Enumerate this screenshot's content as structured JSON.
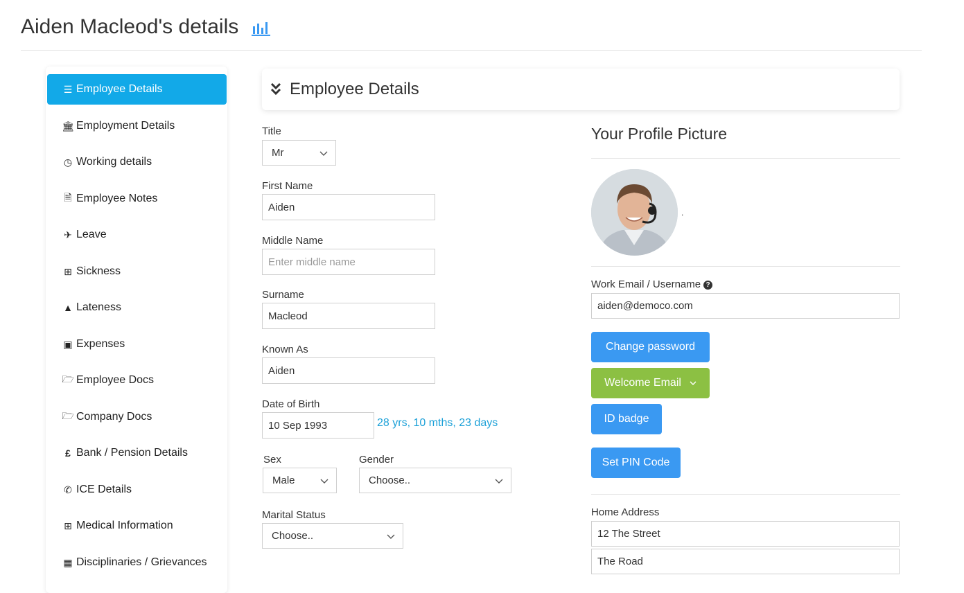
{
  "header": {
    "title": "Aiden Macleod's details",
    "chart_icon": "bar-chart-icon"
  },
  "sidebar": {
    "items": [
      {
        "label": "Employee Details",
        "icon": "list-icon",
        "active": true
      },
      {
        "label": "Employment Details",
        "icon": "bank-icon"
      },
      {
        "label": "Working details",
        "icon": "clock-icon"
      },
      {
        "label": "Employee Notes",
        "icon": "document-icon"
      },
      {
        "label": "Leave",
        "icon": "plane-icon"
      },
      {
        "label": "Sickness",
        "icon": "medkit-icon"
      },
      {
        "label": "Lateness",
        "icon": "warning-icon"
      },
      {
        "label": "Expenses",
        "icon": "money-icon"
      },
      {
        "label": "Employee Docs",
        "icon": "folder-open-icon"
      },
      {
        "label": "Company Docs",
        "icon": "folder-open-icon"
      },
      {
        "label": "Bank / Pension Details",
        "icon": "pound-icon"
      },
      {
        "label": "ICE Details",
        "icon": "phone-icon"
      },
      {
        "label": "Medical Information",
        "icon": "medkit-icon"
      },
      {
        "label": "Disciplinaries / Grievances",
        "icon": "qrcode-icon"
      }
    ]
  },
  "section": {
    "title": "Employee Details",
    "icon": "double-chevron-down-icon"
  },
  "form": {
    "title_label": "Title",
    "title_value": "Mr",
    "first_name_label": "First Name",
    "first_name_value": "Aiden",
    "middle_name_label": "Middle Name",
    "middle_name_placeholder": "Enter middle name",
    "surname_label": "Surname",
    "surname_value": "Macleod",
    "known_as_label": "Known As",
    "known_as_value": "Aiden",
    "dob_label": "Date of Birth",
    "dob_value": "10 Sep 1993",
    "age_text": "28 yrs, 10 mths, 23 days",
    "sex_label": "Sex",
    "sex_value": "Male",
    "gender_label": "Gender",
    "gender_value": "Choose..",
    "marital_label": "Marital Status",
    "marital_value": "Choose.."
  },
  "profile": {
    "title": "Your Profile Picture",
    "dot": ".",
    "email_label": "Work Email / Username",
    "email_value": "aiden@democo.com",
    "buttons": {
      "change_password": "Change password",
      "welcome_email": "Welcome Email",
      "id_badge": "ID badge",
      "set_pin": "Set PIN Code"
    },
    "home_address_label": "Home Address",
    "address_line1": "12 The Street",
    "address_line2": "The Road"
  },
  "colors": {
    "accent": "#12a9e8",
    "button_blue": "#3a99f2",
    "button_green": "#8cc043",
    "link": "#1da1d8"
  }
}
